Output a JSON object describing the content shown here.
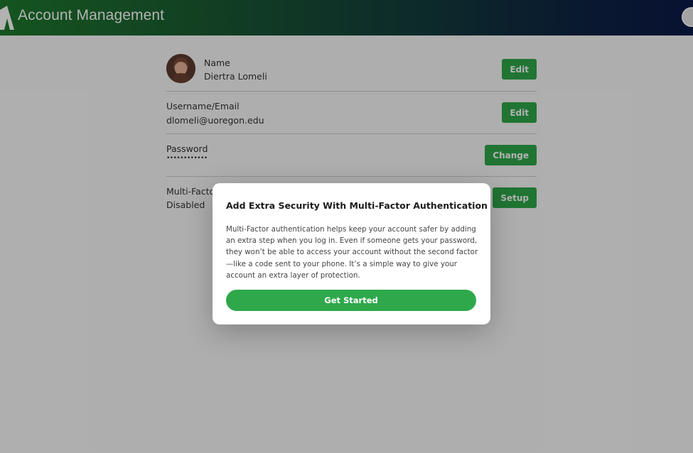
{
  "header": {
    "title": "Account Management"
  },
  "account": {
    "name": {
      "label": "Name",
      "value": "Diertra Lomeli",
      "button": "Edit"
    },
    "email": {
      "label": "Username/Email",
      "value": "dlomeli@uoregon.edu",
      "button": "Edit"
    },
    "password": {
      "label": "Password",
      "value": "••••••••••••",
      "button": "Change"
    },
    "mfa": {
      "label": "Multi-Factor",
      "value": "Disabled",
      "button": "Setup"
    }
  },
  "modal": {
    "title": "Add Extra Security With Multi-Factor Authentication",
    "body": "Multi-Factor authentication helps keep your account safer by adding an extra step when you log in. Even if someone gets your password, they won’t be able to access your account without the second factor—like a code sent to your phone. It’s a simple way to give your account an extra layer of protection.",
    "cta": "Get Started"
  },
  "colors": {
    "accent": "#2ea84a",
    "header_start": "#1f7a2d",
    "header_end": "#0b1a48"
  }
}
